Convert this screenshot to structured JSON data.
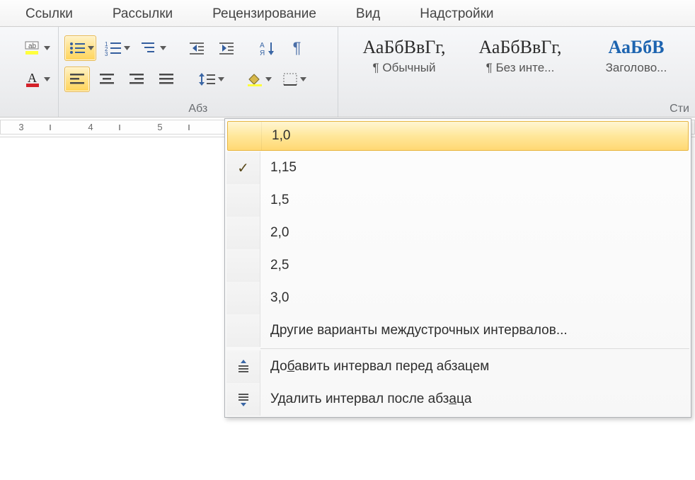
{
  "colors": {
    "accent": "#ffdd7a",
    "accent_border": "#e7b84c",
    "link_blue": "#1d64b0"
  },
  "tabs": [
    "Ссылки",
    "Рассылки",
    "Рецензирование",
    "Вид",
    "Надстройки"
  ],
  "groups": {
    "font_label": "",
    "paragraph_label": "Абз",
    "styles_label": "Сти"
  },
  "icons": {
    "change_case": "Aa",
    "highlight": "ab",
    "font_color": "A",
    "bullets": "bullets",
    "numbering": "numbering",
    "multilevel": "multilevel",
    "decrease_indent": "dec-indent",
    "increase_indent": "inc-indent",
    "sort": "A↓",
    "show_marks": "¶",
    "align_left": "align-left",
    "align_center": "align-center",
    "align_right": "align-right",
    "justify": "justify",
    "line_spacing": "line-spacing",
    "shading": "shading",
    "borders": "borders"
  },
  "styles": [
    {
      "sample": "АаБбВвГг,",
      "name": "¶ Обычный",
      "blue": false
    },
    {
      "sample": "АаБбВвГг,",
      "name": "¶ Без инте...",
      "blue": false
    },
    {
      "sample": "АаБбВ",
      "name": "Заголово...",
      "blue": true
    }
  ],
  "ruler": {
    "start": 3,
    "end": 12
  },
  "menu": {
    "items": [
      {
        "value": "1,0",
        "checked": false,
        "hover": true
      },
      {
        "value": "1,15",
        "checked": true,
        "hover": false
      },
      {
        "value": "1,5",
        "checked": false,
        "hover": false
      },
      {
        "value": "2,0",
        "checked": false,
        "hover": false
      },
      {
        "value": "2,5",
        "checked": false,
        "hover": false
      },
      {
        "value": "3,0",
        "checked": false,
        "hover": false
      }
    ],
    "more": "Другие варианты междустрочных интервалов...",
    "add_before": {
      "pre": "До",
      "u": "б",
      "post": "авить интервал перед абзацем"
    },
    "remove_after": {
      "pre": "Удалить интервал после абз",
      "u": "а",
      "post": "ца"
    }
  }
}
